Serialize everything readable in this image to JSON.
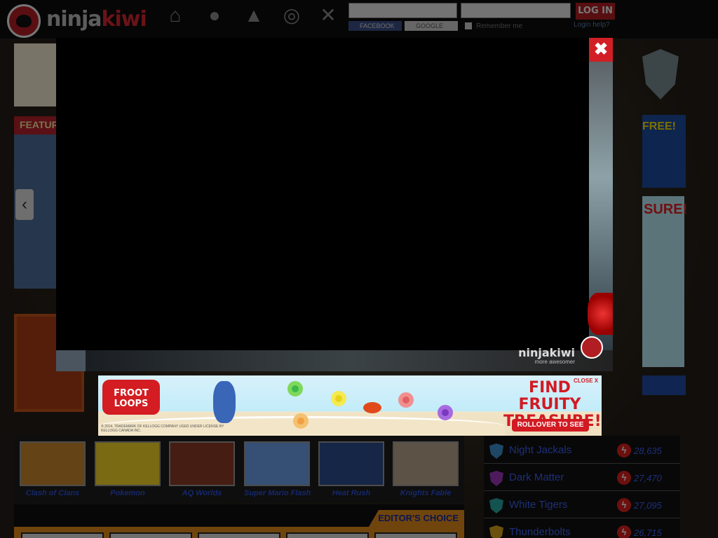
{
  "header": {
    "logo": {
      "prefix": "ninja",
      "suffix": "kiwi"
    },
    "nav_icons": [
      "home-icon",
      "lightbulb-icon",
      "shirt-icon",
      "chat-bubbles-icon",
      "crossed-swords-icon"
    ],
    "login": {
      "button_label": "LOG IN",
      "facebook_label": "FACEBOOK",
      "google_label": "GOOGLE",
      "remember_label": "Remember me",
      "help_label": "Login help?"
    }
  },
  "background_page": {
    "featured_label": "FEATURED",
    "right_free_label": "FREE!",
    "right_treasure_label": "SURE!"
  },
  "modal": {
    "close_label": "✖",
    "brand": "ninjakiwi",
    "tagline": "more awesomer"
  },
  "banner_ad": {
    "logo_label": "FROOT LOOPS",
    "title": "FIND FRUITY TREASURE!",
    "close_label": "CLOSE X",
    "cta_label": "ROLLOVER TO SEE",
    "legal": "® 2014, TRADEMARK OF KELLOGG COMPANY USED UNDER LICENSE BY KELLOGG CANADA INC."
  },
  "games": [
    {
      "name": "Clash of Clans",
      "color": "#c9862e"
    },
    {
      "name": "Pokemon",
      "color": "#f5d426"
    },
    {
      "name": "AQ Worlds",
      "color": "#8a3b24"
    },
    {
      "name": "Super Mario Flash",
      "color": "#6aa0e8"
    },
    {
      "name": "Heat Rush",
      "color": "#2b4d8c"
    },
    {
      "name": "Knights Fable",
      "color": "#b9a58a"
    }
  ],
  "editors_choice_label": "EDITOR'S CHOICE",
  "leaderboard": [
    {
      "name": "Night Jackals",
      "score": "28,635",
      "color": "#3d8fcf"
    },
    {
      "name": "Dark Matter",
      "score": "27,470",
      "color": "#9b36b8"
    },
    {
      "name": "White Tigers",
      "score": "27,095",
      "color": "#27a7a0"
    },
    {
      "name": "Thunderbolts",
      "score": "26,715",
      "color": "#d7a21a"
    }
  ]
}
